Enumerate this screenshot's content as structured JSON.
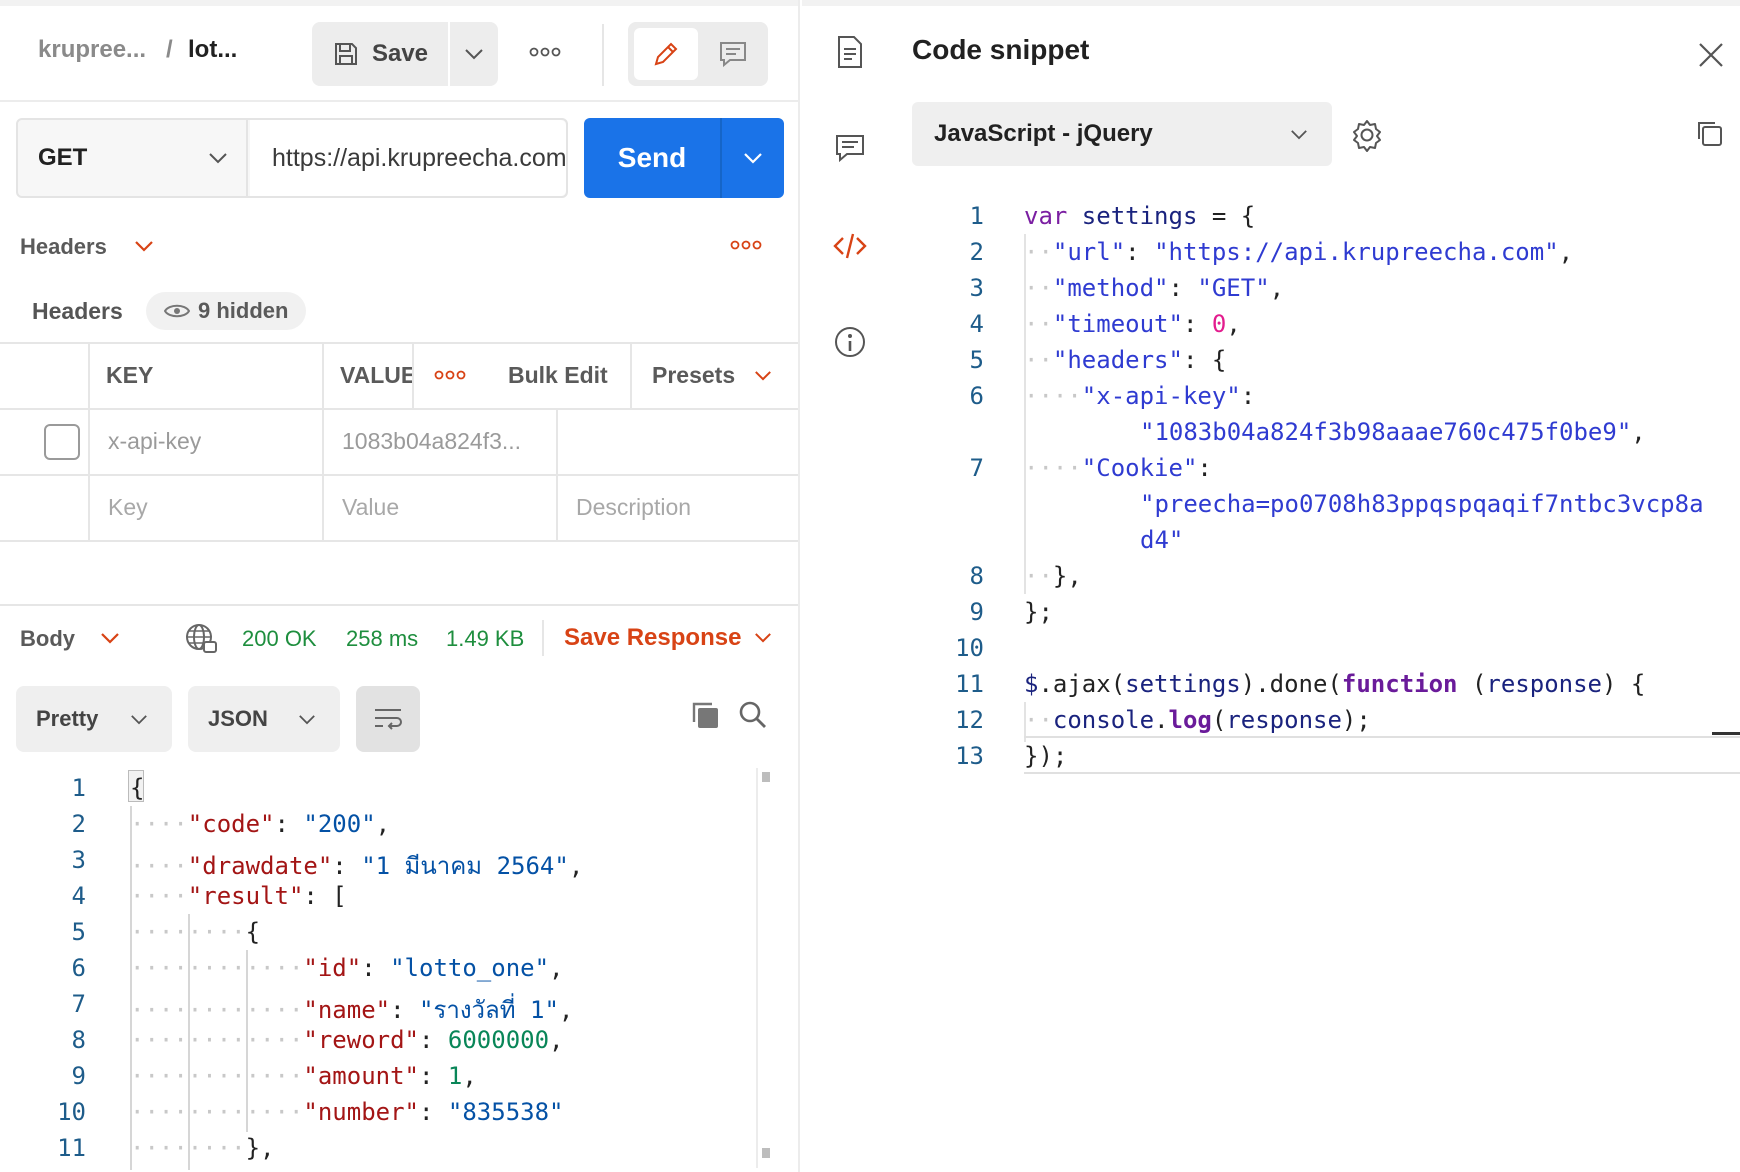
{
  "request": {
    "breadcrumb": {
      "collection": "krupree...",
      "separator": "/",
      "name": "lot..."
    },
    "save_label": "Save",
    "method": "GET",
    "url": "https://api.krupreecha.com",
    "send_label": "Send"
  },
  "headers_section": {
    "title": "Headers",
    "subtitle": "Headers",
    "hidden_badge": "9 hidden",
    "columns": {
      "key": "KEY",
      "value": "VALUE",
      "bulk_edit": "Bulk Edit",
      "presets": "Presets"
    },
    "rows": [
      {
        "key": "x-api-key",
        "value": "1083b04a824f3..."
      }
    ],
    "placeholders": {
      "key": "Key",
      "value": "Value",
      "description": "Description"
    }
  },
  "response": {
    "title": "Body",
    "status": "200 OK",
    "time": "258 ms",
    "size": "1.49 KB",
    "save_response": "Save Response",
    "format": "Pretty",
    "language": "JSON"
  },
  "response_lines": [
    {
      "n": "1"
    },
    {
      "n": "2"
    },
    {
      "n": "3"
    },
    {
      "n": "4"
    },
    {
      "n": "5"
    },
    {
      "n": "6"
    },
    {
      "n": "7"
    },
    {
      "n": "8"
    },
    {
      "n": "9"
    },
    {
      "n": "10"
    },
    {
      "n": "11"
    }
  ],
  "response_body": {
    "code_key": "\"code\"",
    "code_val": "\"200\"",
    "drawdate_key": "\"drawdate\"",
    "drawdate_val": "\"1 มีนาคม 2564\"",
    "result_key": "\"result\"",
    "id_key": "\"id\"",
    "id_val": "\"lotto_one\"",
    "name_key": "\"name\"",
    "name_val": "\"รางวัลที่ 1\"",
    "reward_key": "\"reword\"",
    "reward_val": "6000000",
    "amount_key": "\"amount\"",
    "amount_val": "1",
    "number_key": "\"number\"",
    "number_val": "\"835538\""
  },
  "snippet": {
    "title": "Code snippet",
    "language": "JavaScript - jQuery",
    "line_numbers": [
      "1",
      "2",
      "3",
      "4",
      "5",
      "6",
      "7",
      "8",
      "9",
      "10",
      "11",
      "12",
      "13"
    ],
    "url": "\"https://api.krupreecha.com\"",
    "method": "\"GET\"",
    "timeout": "0",
    "api_key": "\"1083b04a824f3b98aaae760c475f0be9\"",
    "cookie_1": "\"preecha=po0708h83ppqspqaqif7ntbc3vcp8a",
    "cookie_2": "d4\""
  },
  "colors": {
    "send": "#1a73e8",
    "accent": "#d84315",
    "status_ok": "#1e8e3e"
  }
}
